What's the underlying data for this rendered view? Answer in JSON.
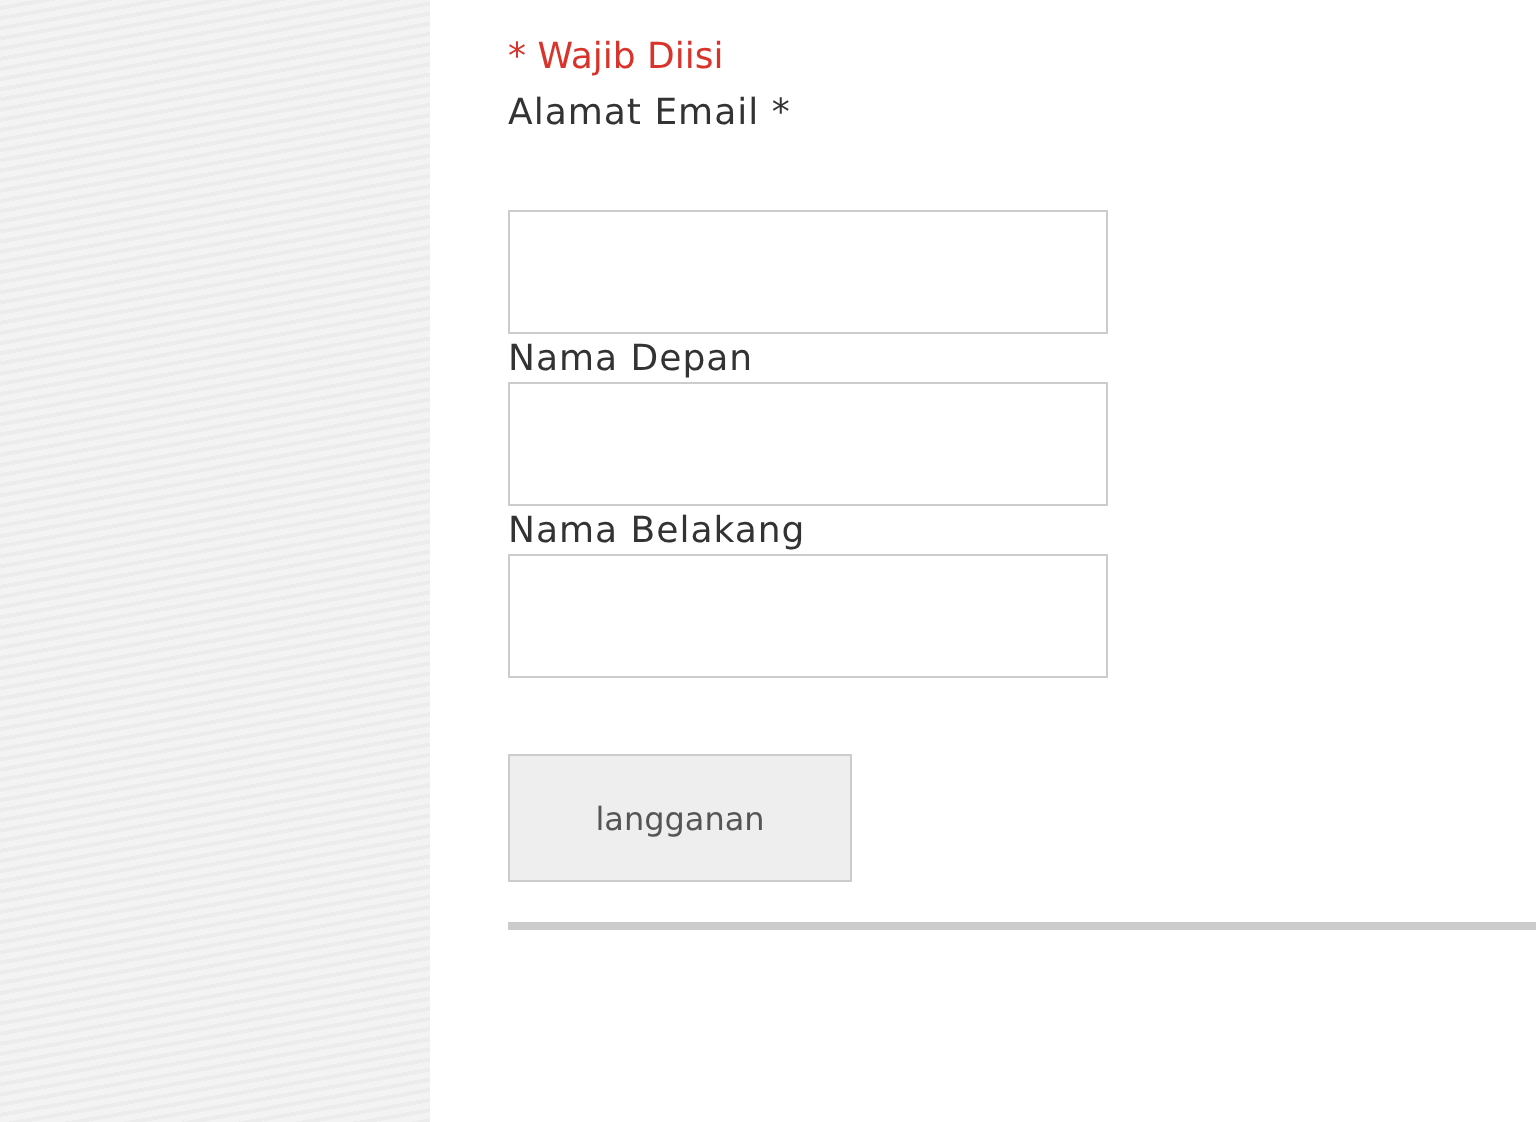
{
  "required_note": "* Wajib Diisi",
  "fields": [
    {
      "label": "Alamat Email *"
    },
    {
      "label": "Nama Depan"
    },
    {
      "label": "Nama Belakang"
    }
  ],
  "submit_button": "langganan"
}
